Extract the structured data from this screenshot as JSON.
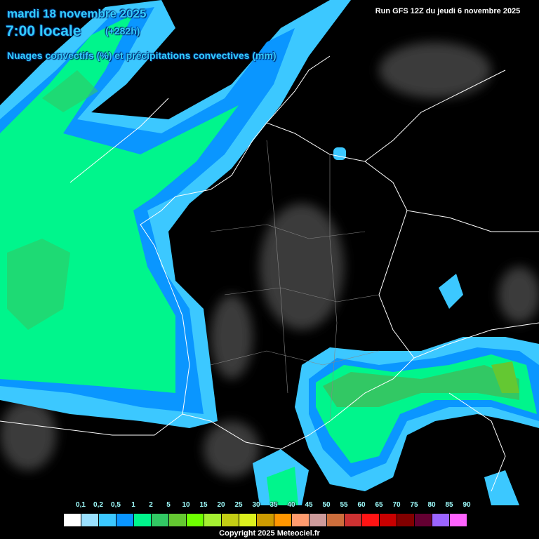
{
  "header": {
    "date": "mardi 18 novembre 2025",
    "hour": "7:00 locale",
    "offset": "(+282h)",
    "subtitle": "Nuages convectifs (%) et précipitations convectives (mm)",
    "run": "Run GFS 12Z du jeudi 6 novembre 2025"
  },
  "legend": {
    "labels": [
      "0,1",
      "0,2",
      "0,5",
      "1",
      "2",
      "5",
      "10",
      "15",
      "20",
      "25",
      "30",
      "35",
      "40",
      "45",
      "50",
      "55",
      "60",
      "65",
      "70",
      "75",
      "80",
      "85",
      "90"
    ],
    "colors": [
      "#ffffff",
      "#9be1ff",
      "#3cc8ff",
      "#0a96ff",
      "#00f58c",
      "#32c864",
      "#64c832",
      "#6eff00",
      "#a5f032",
      "#c3cd14",
      "#dcf01e",
      "#cd9b00",
      "#ff9600",
      "#ff9b6e",
      "#cd9b9b",
      "#cd6e3c",
      "#cd3232",
      "#ff1414",
      "#c80000",
      "#820000",
      "#640032",
      "#9b64ff",
      "#ff64ff"
    ]
  },
  "copyright": "Copyright 2025 Meteociel.fr"
}
